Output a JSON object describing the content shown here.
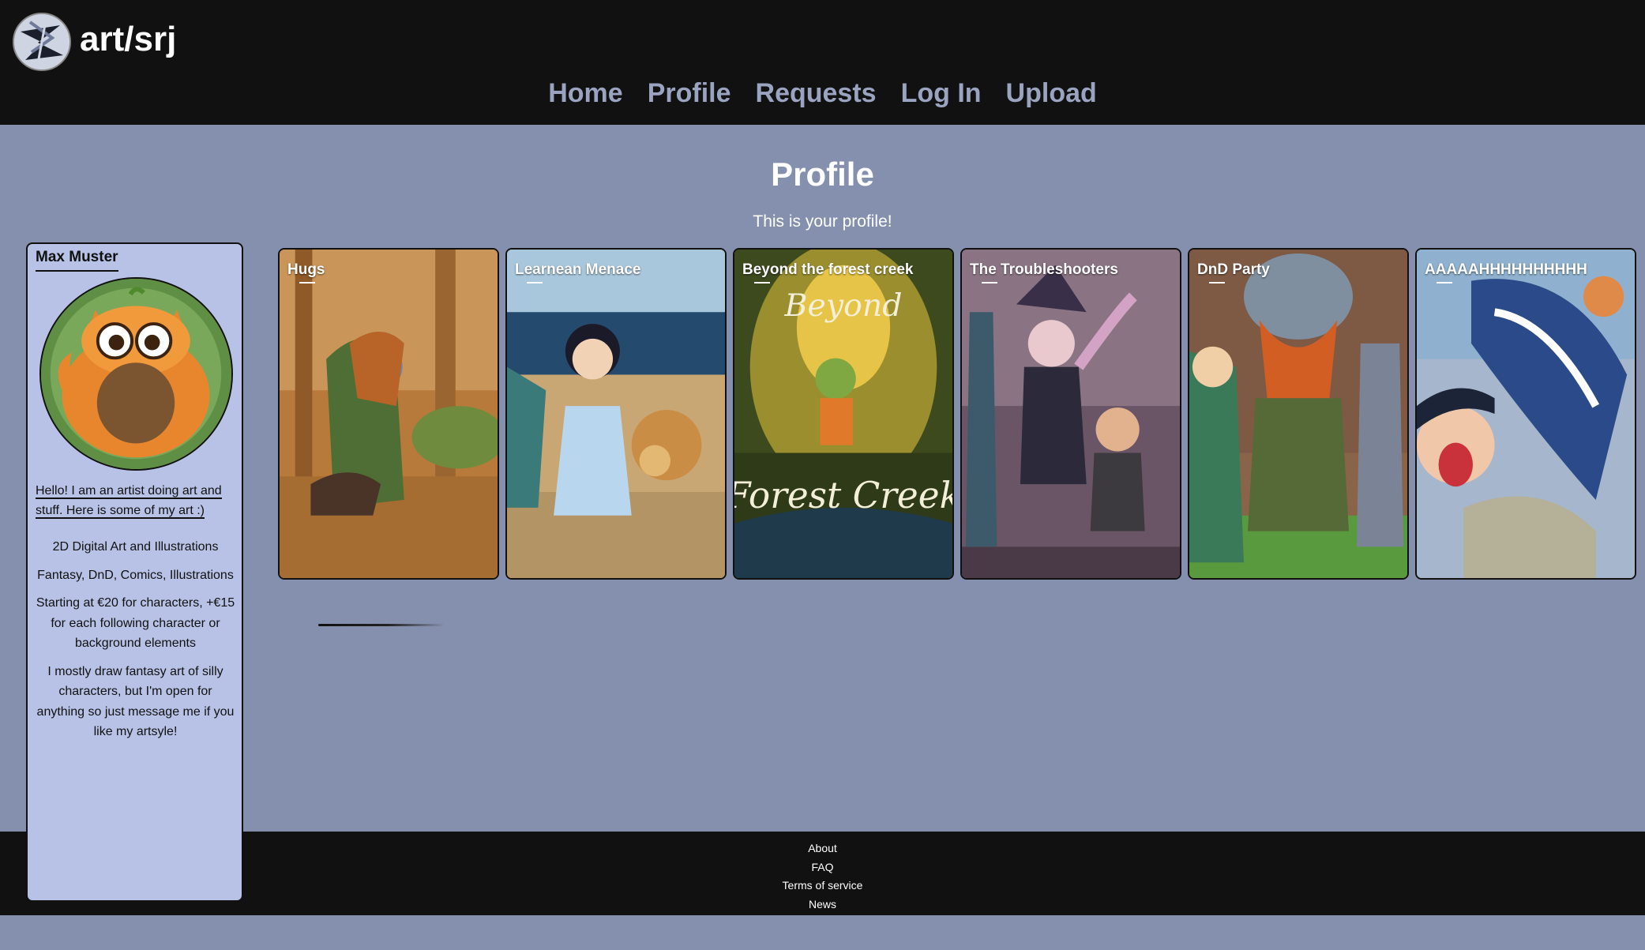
{
  "header": {
    "site_title": "art/srj",
    "nav": [
      {
        "label": "Home"
      },
      {
        "label": "Profile"
      },
      {
        "label": "Requests"
      },
      {
        "label": "Log In"
      },
      {
        "label": "Upload"
      }
    ]
  },
  "main": {
    "title": "Profile",
    "subtitle": "This is your profile!"
  },
  "sidebar": {
    "name": "Max Muster",
    "intro": "Hello! I am an artist doing art and stuff. Here is some of my art :)",
    "details": [
      "2D Digital Art and Illustrations",
      "Fantasy, DnD, Comics, Illustrations",
      "Starting at €20 for characters, +€15 for each following character or background elements",
      "I mostly draw fantasy art of silly characters, but I'm open for anything so just message me if you like my artsyle!"
    ]
  },
  "gallery": [
    {
      "title": "Hugs"
    },
    {
      "title": "Learnean Menace"
    },
    {
      "title": "Beyond the forest creek"
    },
    {
      "title": "The Troubleshooters"
    },
    {
      "title": "DnD Party"
    },
    {
      "title": "AAAAAHHHHHHHHHH"
    }
  ],
  "footer": {
    "links": [
      "About",
      "FAQ",
      "Terms of service",
      "News"
    ]
  },
  "colors": {
    "header_bg": "#111111",
    "page_bg": "#8590ae",
    "sidebar_bg": "#b7c2e6",
    "nav_text": "#9aa3c0"
  }
}
